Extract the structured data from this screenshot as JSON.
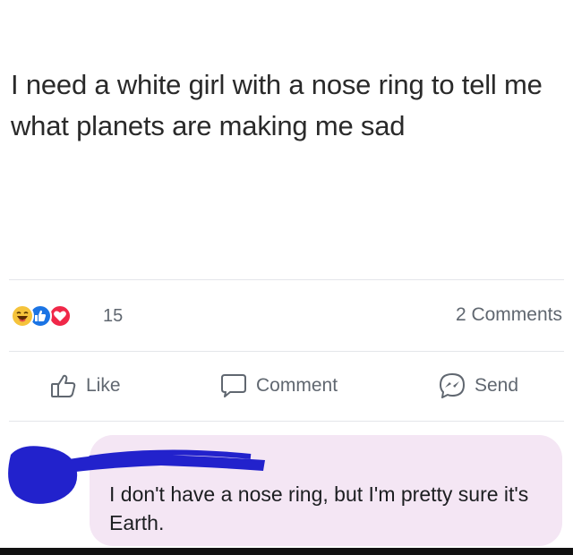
{
  "post": {
    "text": "I need a white girl with a nose ring to tell me what planets are making me sad"
  },
  "stats": {
    "reaction_icons": [
      "haha-icon",
      "like-icon",
      "love-icon"
    ],
    "reaction_count": "15",
    "comments_label": "2 Comments"
  },
  "actions": {
    "like_label": "Like",
    "comment_label": "Comment",
    "send_label": "Send"
  },
  "comment": {
    "text": "I don't have a nose ring, but I'm pretty sure it's Earth."
  },
  "colors": {
    "bubble": "#f4e6f4",
    "redaction": "#2222cc",
    "muted_text": "#606770"
  }
}
